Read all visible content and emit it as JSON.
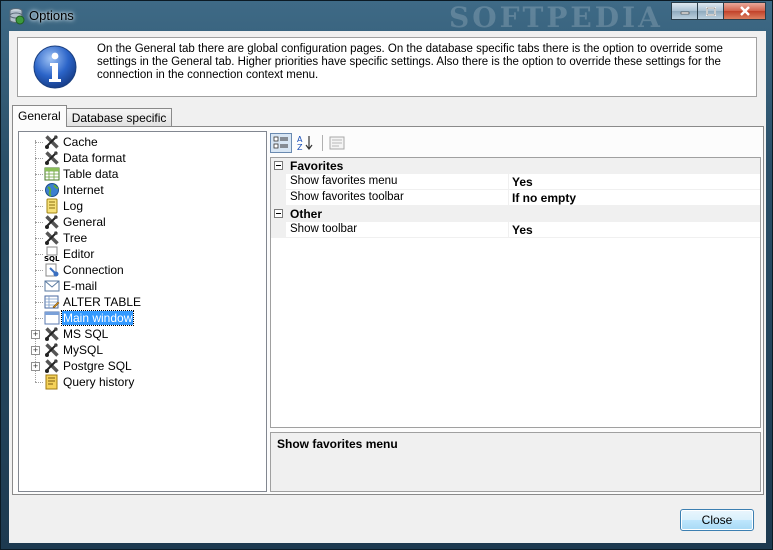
{
  "window": {
    "title": "Options",
    "watermark": "SOFTPEDIA"
  },
  "info": {
    "text": "On the General tab there are global configuration pages. On the database specific tabs there is the option to override some settings in the General tab. Higher priorities have specific settings. Also there is the option to override these settings for the connection in the connection context menu."
  },
  "tabs": [
    {
      "label": "General",
      "active": true
    },
    {
      "label": "Database specific",
      "active": false
    }
  ],
  "tree": {
    "items": [
      {
        "label": "Cache",
        "icon": "tools-icon"
      },
      {
        "label": "Data format",
        "icon": "tools-icon"
      },
      {
        "label": "Table data",
        "icon": "table-icon"
      },
      {
        "label": "Internet",
        "icon": "globe-icon"
      },
      {
        "label": "Log",
        "icon": "log-icon"
      },
      {
        "label": "General",
        "icon": "tools-icon"
      },
      {
        "label": "Tree",
        "icon": "tools-icon"
      },
      {
        "label": "Editor",
        "icon": "sql-editor-icon"
      },
      {
        "label": "Connection",
        "icon": "connection-icon"
      },
      {
        "label": "E-mail",
        "icon": "email-icon"
      },
      {
        "label": "ALTER TABLE",
        "icon": "alter-table-icon"
      },
      {
        "label": "Main window",
        "icon": "window-icon",
        "selected": true
      },
      {
        "label": "MS SQL",
        "icon": "tools-icon",
        "expandable": true
      },
      {
        "label": "MySQL",
        "icon": "tools-icon",
        "expandable": true
      },
      {
        "label": "Postgre SQL",
        "icon": "tools-icon",
        "expandable": true
      },
      {
        "label": "Query history",
        "icon": "history-icon"
      }
    ]
  },
  "propertygrid": {
    "categories": [
      {
        "name": "Favorites",
        "properties": [
          {
            "name": "Show favorites menu",
            "value": "Yes"
          },
          {
            "name": "Show favorites toolbar",
            "value": "If no empty"
          }
        ]
      },
      {
        "name": "Other",
        "properties": [
          {
            "name": "Show toolbar",
            "value": "Yes"
          }
        ]
      }
    ],
    "description_title": "Show favorites menu"
  },
  "buttons": {
    "close": "Close"
  }
}
